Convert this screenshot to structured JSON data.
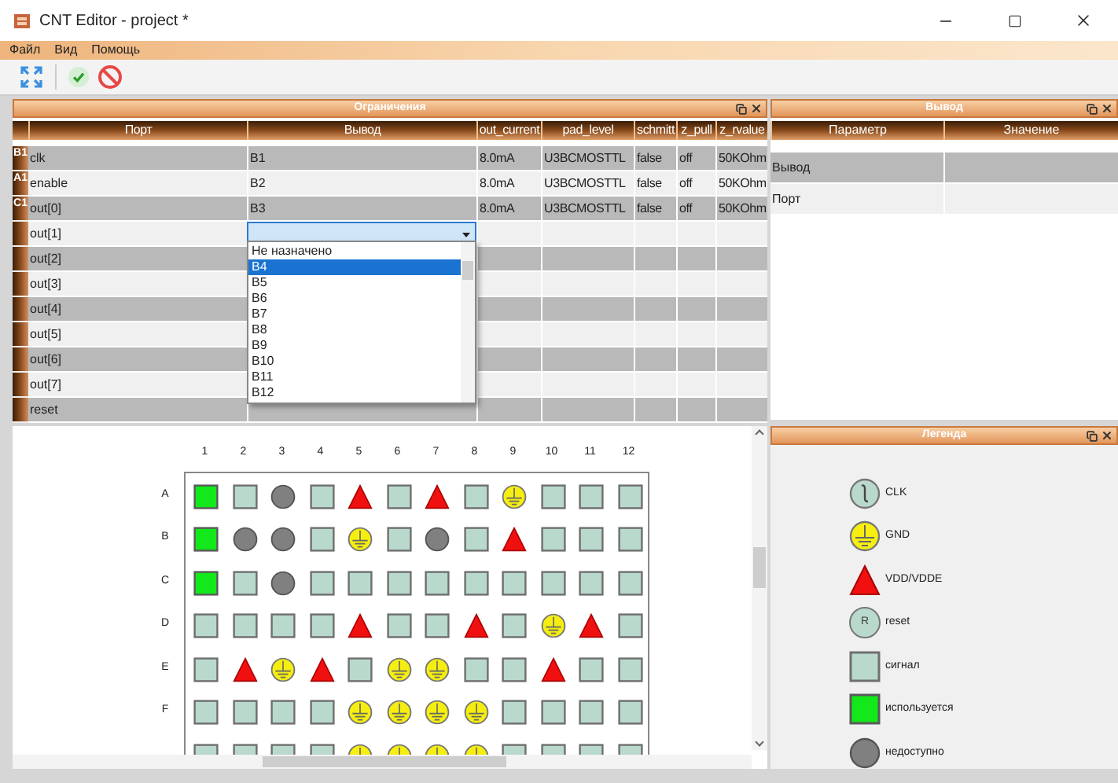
{
  "window": {
    "title": "CNT Editor - project *"
  },
  "menu": [
    "Файл",
    "Вид",
    "Помощь"
  ],
  "constraints": {
    "title": "Ограничения",
    "columns": [
      "Порт",
      "Вывод",
      "out_current",
      "pad_level",
      "schmitt",
      "z_pull",
      "z_rvalue"
    ],
    "rows": [
      {
        "badge": "B1",
        "port": "clk",
        "pin": "B1",
        "out_current": "8.0mA",
        "pad_level": "U3BCMOSTTL",
        "schmitt": "false",
        "z_pull": "off",
        "z_rvalue": "50KOhm",
        "editing": false
      },
      {
        "badge": "A1",
        "port": "enable",
        "pin": "B2",
        "out_current": "8.0mA",
        "pad_level": "U3BCMOSTTL",
        "schmitt": "false",
        "z_pull": "off",
        "z_rvalue": "50KOhm",
        "editing": false
      },
      {
        "badge": "C1",
        "port": "out[0]",
        "pin": "B3",
        "out_current": "8.0mA",
        "pad_level": "U3BCMOSTTL",
        "schmitt": "false",
        "z_pull": "off",
        "z_rvalue": "50KOhm",
        "editing": false
      },
      {
        "port": "out[1]",
        "editing": true
      },
      {
        "port": "out[2]",
        "editing": false
      },
      {
        "port": "out[3]",
        "editing": false
      },
      {
        "port": "out[4]",
        "editing": false
      },
      {
        "port": "out[5]",
        "editing": false
      },
      {
        "port": "out[6]",
        "editing": false
      },
      {
        "port": "out[7]",
        "editing": false
      },
      {
        "port": "reset",
        "editing": false
      }
    ],
    "dropdown": [
      {
        "label": "Не назначено",
        "selected": false
      },
      {
        "label": "B4",
        "selected": true
      },
      {
        "label": "B5",
        "selected": false
      },
      {
        "label": "B6",
        "selected": false
      },
      {
        "label": "B7",
        "selected": false
      },
      {
        "label": "B8",
        "selected": false
      },
      {
        "label": "B9",
        "selected": false
      },
      {
        "label": "B10",
        "selected": false
      },
      {
        "label": "B11",
        "selected": false
      },
      {
        "label": "B12",
        "selected": false
      }
    ]
  },
  "output": {
    "title": "Вывод",
    "columns": [
      "Параметр",
      "Значение"
    ],
    "rows": [
      {
        "parameter": "Вывод"
      },
      {
        "parameter": "Порт"
      }
    ]
  },
  "pin_map": {
    "column_labels": [
      "1",
      "2",
      "3",
      "4",
      "5",
      "6",
      "7",
      "8",
      "9",
      "10",
      "11",
      "12"
    ],
    "rows": [
      {
        "label": "A",
        "pins": [
          {
            "kind": "used"
          },
          {
            "kind": "signal"
          },
          {
            "kind": "unavailable"
          },
          {
            "kind": "signal"
          },
          {
            "kind": "vdd"
          },
          {
            "kind": "signal"
          },
          {
            "kind": "vdd"
          },
          {
            "kind": "signal"
          },
          {
            "kind": "gnd"
          },
          {
            "kind": "signal"
          },
          {
            "kind": "signal"
          },
          {
            "kind": "signal"
          }
        ]
      },
      {
        "label": "B",
        "pins": [
          {
            "kind": "used"
          },
          {
            "kind": "unavailable"
          },
          {
            "kind": "unavailable"
          },
          {
            "kind": "signal"
          },
          {
            "kind": "gnd"
          },
          {
            "kind": "signal"
          },
          {
            "kind": "unavailable"
          },
          {
            "kind": "signal"
          },
          {
            "kind": "vdd"
          },
          {
            "kind": "signal"
          },
          {
            "kind": "signal"
          },
          {
            "kind": "signal"
          }
        ]
      },
      {
        "label": "C",
        "pins": [
          {
            "kind": "used"
          },
          {
            "kind": "signal"
          },
          {
            "kind": "unavailable"
          },
          {
            "kind": "signal"
          },
          {
            "kind": "signal"
          },
          {
            "kind": "signal"
          },
          {
            "kind": "signal"
          },
          {
            "kind": "signal"
          },
          {
            "kind": "signal"
          },
          {
            "kind": "signal"
          },
          {
            "kind": "signal"
          },
          {
            "kind": "signal"
          }
        ]
      },
      {
        "label": "D",
        "pins": [
          {
            "kind": "signal"
          },
          {
            "kind": "signal"
          },
          {
            "kind": "signal"
          },
          {
            "kind": "signal"
          },
          {
            "kind": "vdd"
          },
          {
            "kind": "signal"
          },
          {
            "kind": "signal"
          },
          {
            "kind": "vdd"
          },
          {
            "kind": "signal"
          },
          {
            "kind": "gnd"
          },
          {
            "kind": "vdd"
          },
          {
            "kind": "signal"
          }
        ]
      },
      {
        "label": "E",
        "pins": [
          {
            "kind": "signal"
          },
          {
            "kind": "vdd"
          },
          {
            "kind": "gnd"
          },
          {
            "kind": "vdd"
          },
          {
            "kind": "signal"
          },
          {
            "kind": "gnd"
          },
          {
            "kind": "gnd"
          },
          {
            "kind": "signal"
          },
          {
            "kind": "signal"
          },
          {
            "kind": "vdd"
          },
          {
            "kind": "signal"
          },
          {
            "kind": "signal"
          }
        ]
      },
      {
        "label": "F",
        "pins": [
          {
            "kind": "signal"
          },
          {
            "kind": "signal"
          },
          {
            "kind": "signal"
          },
          {
            "kind": "signal"
          },
          {
            "kind": "gnd"
          },
          {
            "kind": "gnd"
          },
          {
            "kind": "gnd"
          },
          {
            "kind": "gnd"
          },
          {
            "kind": "signal"
          },
          {
            "kind": "signal"
          },
          {
            "kind": "signal"
          },
          {
            "kind": "signal"
          }
        ]
      },
      {
        "pins": [
          {
            "kind": "signal"
          },
          {
            "kind": "signal"
          },
          {
            "kind": "signal"
          },
          {
            "kind": "signal"
          },
          {
            "kind": "gnd"
          },
          {
            "kind": "gnd"
          },
          {
            "kind": "gnd"
          },
          {
            "kind": "gnd"
          },
          {
            "kind": "signal"
          },
          {
            "kind": "signal"
          },
          {
            "kind": "signal"
          },
          {
            "kind": "signal"
          }
        ]
      }
    ]
  },
  "legend": {
    "title": "Легенда",
    "items": [
      {
        "kind": "clk",
        "label": "CLK"
      },
      {
        "kind": "gnd",
        "label": "GND"
      },
      {
        "kind": "vdd",
        "label": "VDD/VDDE"
      },
      {
        "kind": "reset",
        "symbol": "R",
        "label": "reset"
      },
      {
        "kind": "signal",
        "label": "сигнал"
      },
      {
        "kind": "used",
        "label": "используется"
      },
      {
        "kind": "unavailable",
        "label": "недоступно"
      }
    ]
  }
}
